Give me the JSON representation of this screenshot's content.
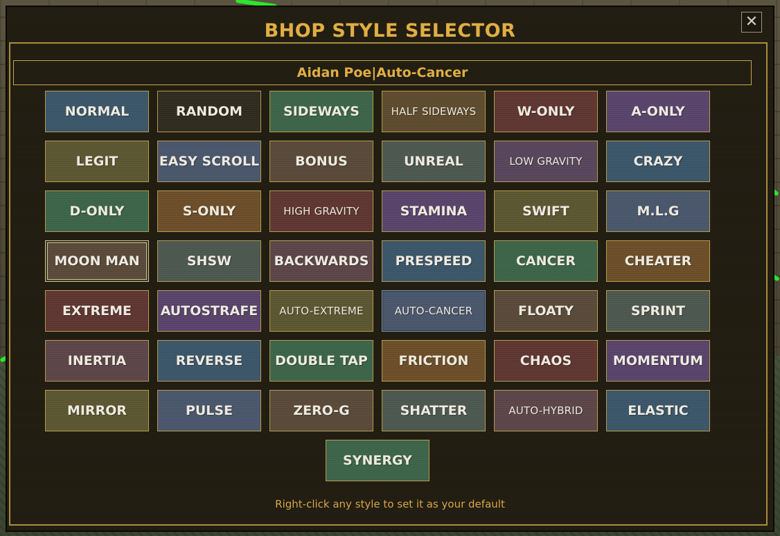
{
  "window": {
    "title": "BHOP STYLE SELECTOR",
    "close_glyph": "✕"
  },
  "player": {
    "name": "Aidan Poe",
    "separator": "|",
    "current_style": "Auto-Cancer"
  },
  "styles": [
    {
      "label": "NORMAL",
      "color": "#3a5468"
    },
    {
      "label": "RANDOM",
      "color": "#2f2a1e"
    },
    {
      "label": "SIDEWAYS",
      "color": "#3b6347"
    },
    {
      "label": "HALF SIDEWAYS",
      "color": "#5d4a2d"
    },
    {
      "label": "W-ONLY",
      "color": "#5d3430"
    },
    {
      "label": "A-ONLY",
      "color": "#57426a"
    },
    {
      "label": "LEGIT",
      "color": "#5a5530"
    },
    {
      "label": "EASY SCROLL",
      "color": "#48556a"
    },
    {
      "label": "BONUS",
      "color": "#574838"
    },
    {
      "label": "UNREAL",
      "color": "#4b564f"
    },
    {
      "label": "LOW GRAVITY",
      "color": "#56455a"
    },
    {
      "label": "CRAZY",
      "color": "#3a5468"
    },
    {
      "label": "D-ONLY",
      "color": "#3b6347"
    },
    {
      "label": "S-ONLY",
      "color": "#6a4d28"
    },
    {
      "label": "HIGH GRAVITY",
      "color": "#5d3430"
    },
    {
      "label": "STAMINA",
      "color": "#57426a"
    },
    {
      "label": "SWIFT",
      "color": "#5a5530"
    },
    {
      "label": "M.L.G",
      "color": "#48556a"
    },
    {
      "label": "MOON MAN",
      "color": "#574838"
    },
    {
      "label": "SHSW",
      "color": "#4b564f"
    },
    {
      "label": "BACKWARDS",
      "color": "#5b4448"
    },
    {
      "label": "PRESPEED",
      "color": "#3a5468"
    },
    {
      "label": "CANCER",
      "color": "#3b6347"
    },
    {
      "label": "CHEATER",
      "color": "#6a4d28"
    },
    {
      "label": "EXTREME",
      "color": "#5d3430"
    },
    {
      "label": "AUTOSTRAFE",
      "color": "#57426a"
    },
    {
      "label": "AUTO-EXTREME",
      "color": "#5a5530"
    },
    {
      "label": "AUTO-CANCER",
      "color": "#48556a"
    },
    {
      "label": "FLOATY",
      "color": "#574838"
    },
    {
      "label": "SPRINT",
      "color": "#4b564f"
    },
    {
      "label": "INERTIA",
      "color": "#5b4448"
    },
    {
      "label": "REVERSE",
      "color": "#3a5468"
    },
    {
      "label": "DOUBLE TAP",
      "color": "#3b6347"
    },
    {
      "label": "FRICTION",
      "color": "#6a4d28"
    },
    {
      "label": "CHAOS",
      "color": "#5d3430"
    },
    {
      "label": "MOMENTUM",
      "color": "#57426a"
    },
    {
      "label": "MIRROR",
      "color": "#5a5530"
    },
    {
      "label": "PULSE",
      "color": "#48556a"
    },
    {
      "label": "ZERO-G",
      "color": "#574838"
    },
    {
      "label": "SHATTER",
      "color": "#4b564f"
    },
    {
      "label": "AUTO-HYBRID",
      "color": "#5b4448"
    },
    {
      "label": "ELASTIC",
      "color": "#3a5468"
    },
    {
      "label": "SYNERGY",
      "color": "#3b6347"
    }
  ],
  "footer": {
    "hint": "Right-click any style to set it as your default"
  },
  "colors": {
    "title_gold": "#e0ae44",
    "frame_gold": "#a88d3f",
    "panel_bg": "#201c10"
  }
}
